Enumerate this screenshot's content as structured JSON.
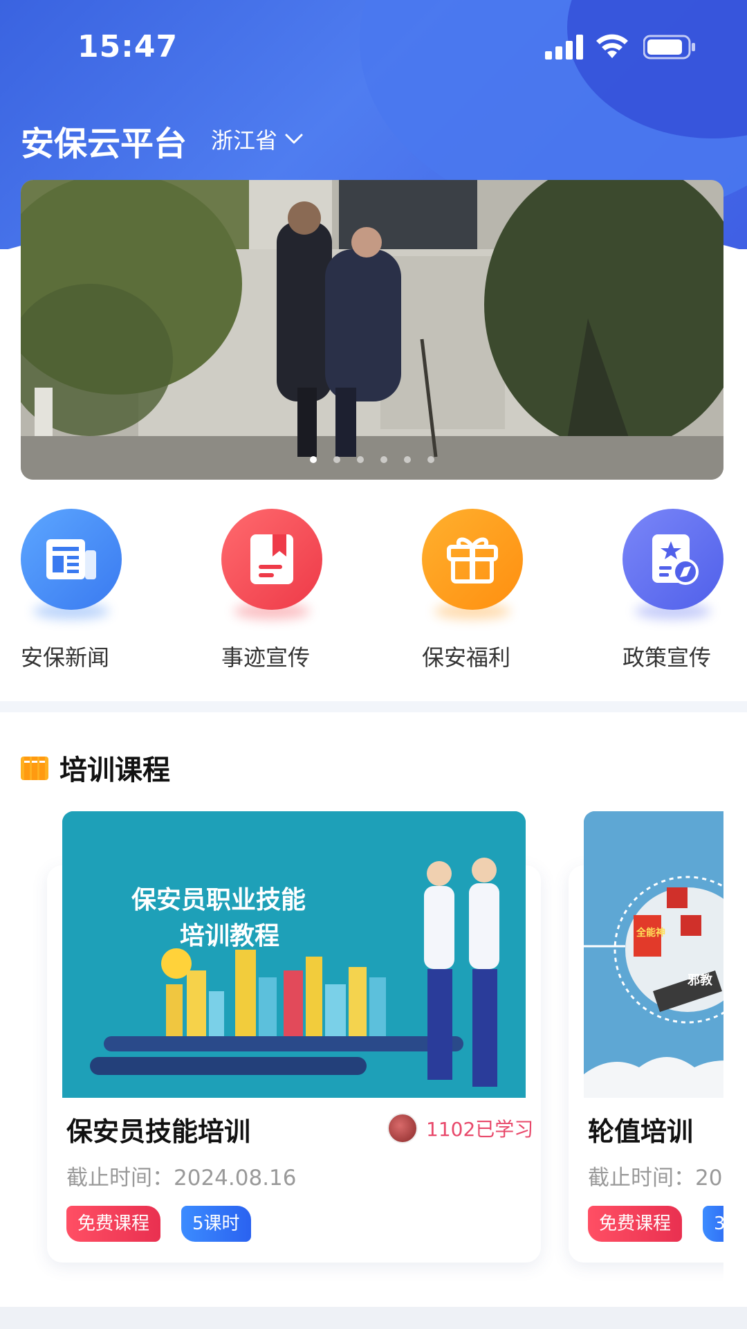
{
  "status_bar": {
    "time": "15:47"
  },
  "header": {
    "app_title": "安保云平台",
    "region": "浙江省"
  },
  "banner": {
    "slide_count": 6,
    "active_slide": 1
  },
  "quick_menu": [
    {
      "label": "安保新闻",
      "icon": "newspaper-icon",
      "color": "#3f86f4"
    },
    {
      "label": "事迹宣传",
      "icon": "bookmark-book-icon",
      "color": "#f24a55"
    },
    {
      "label": "保安福利",
      "icon": "gift-icon",
      "color": "#ff9b1c"
    },
    {
      "label": "政策宣传",
      "icon": "policy-document-icon",
      "color": "#5b6ff0"
    }
  ],
  "training_section": {
    "title": "培训课程",
    "courses": [
      {
        "image_text_line1": "保安员职业技能",
        "image_text_line2": "培训教程",
        "name": "保安员技能培训",
        "learners": "1102已学习",
        "deadline": "截止时间：2024.08.16",
        "tags": [
          "免费课程",
          "5课时"
        ]
      },
      {
        "image_text_line1": "全能神",
        "image_text_line2": "邪教",
        "name": "轮值培训",
        "deadline": "截止时间：20",
        "tags": [
          "免费课程",
          "3"
        ]
      }
    ]
  },
  "colors": {
    "primary": "#3f6ee8",
    "accent_red": "#e93050",
    "accent_blue": "#2a62f0"
  }
}
